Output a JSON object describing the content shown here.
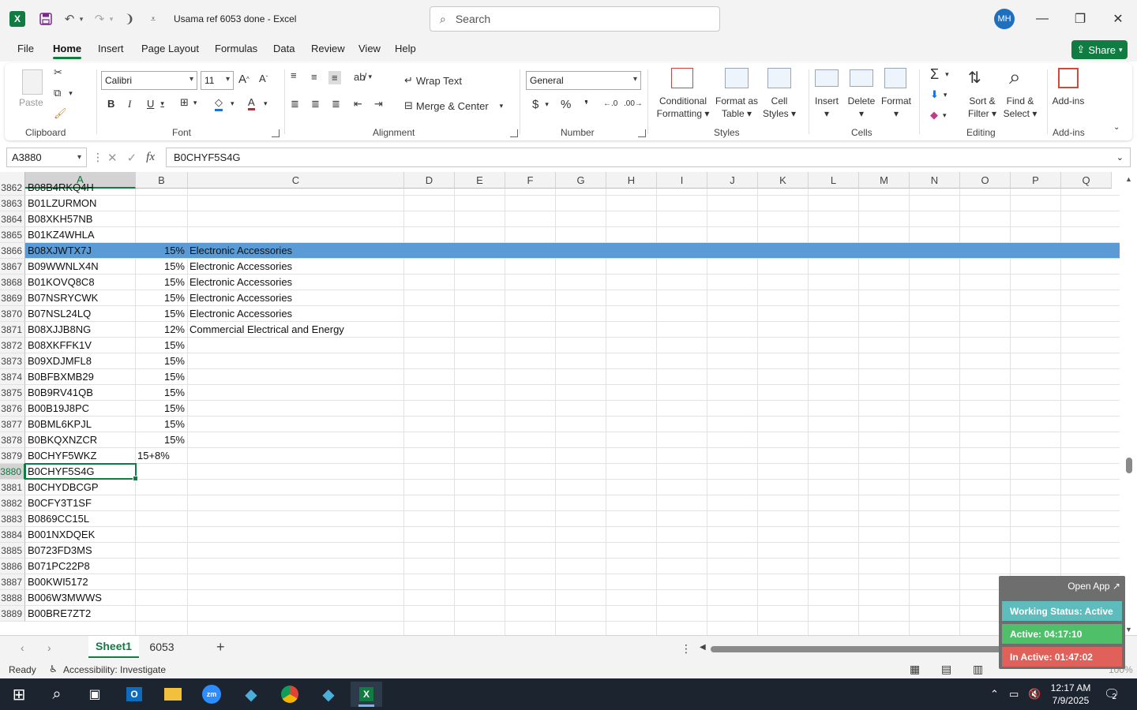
{
  "titlebar": {
    "doc_title": "Usama ref 6053 done  -  Excel",
    "search_placeholder": "Search",
    "avatar_initials": "MH",
    "qa_icons": [
      "save-icon",
      "undo-icon",
      "redo-icon",
      "touch-mode-icon",
      "customize-icon"
    ]
  },
  "menu": {
    "tabs": [
      "File",
      "Home",
      "Insert",
      "Page Layout",
      "Formulas",
      "Data",
      "Review",
      "View",
      "Help"
    ],
    "active_tab": "Home",
    "share_label": "Share"
  },
  "ribbon": {
    "clipboard": {
      "label": "Clipboard",
      "paste": "Paste"
    },
    "font": {
      "label": "Font",
      "name": "Calibri",
      "size": "11"
    },
    "alignment": {
      "label": "Alignment",
      "wrap": "Wrap Text",
      "merge": "Merge & Center"
    },
    "number": {
      "label": "Number",
      "format": "General"
    },
    "styles": {
      "label": "Styles",
      "cond1": "Conditional",
      "cond2": "Formatting",
      "fmt1": "Format as",
      "fmt2": "Table",
      "cell1": "Cell",
      "cell2": "Styles"
    },
    "cells": {
      "label": "Cells",
      "insert": "Insert",
      "delete": "Delete",
      "format": "Format"
    },
    "editing": {
      "label": "Editing",
      "sort1": "Sort &",
      "sort2": "Filter",
      "find1": "Find &",
      "find2": "Select"
    },
    "addins": {
      "label": "Add-ins",
      "button": "Add-ins"
    }
  },
  "formula_bar": {
    "name_box": "A3880",
    "content": "B0CHYF5S4G"
  },
  "grid": {
    "columns": [
      "A",
      "B",
      "C",
      "D",
      "E",
      "F",
      "G",
      "H",
      "I",
      "J",
      "K",
      "L",
      "M",
      "N",
      "O",
      "P",
      "Q"
    ],
    "selected_column": "A",
    "rows": [
      {
        "n": "3862",
        "a": "B08B4RKQ4H",
        "b": "",
        "c": ""
      },
      {
        "n": "3863",
        "a": "B01LZURMON",
        "b": "",
        "c": ""
      },
      {
        "n": "3864",
        "a": "B08XKH57NB",
        "b": "",
        "c": ""
      },
      {
        "n": "3865",
        "a": "B01KZ4WHLA",
        "b": "",
        "c": ""
      },
      {
        "n": "3866",
        "a": "B08XJWTX7J",
        "b": "15%",
        "c": "Electronic Accessories",
        "highlight": true
      },
      {
        "n": "3867",
        "a": "B09WWNLX4N",
        "b": "15%",
        "c": "Electronic Accessories"
      },
      {
        "n": "3868",
        "a": "B01KOVQ8C8",
        "b": "15%",
        "c": "Electronic Accessories"
      },
      {
        "n": "3869",
        "a": "B07NSRYCWK",
        "b": "15%",
        "c": "Electronic Accessories"
      },
      {
        "n": "3870",
        "a": "B07NSL24LQ",
        "b": "15%",
        "c": "Electronic Accessories"
      },
      {
        "n": "3871",
        "a": "B08XJJB8NG",
        "b": "12%",
        "c": "Commercial Electrical and Energy"
      },
      {
        "n": "3872",
        "a": "B08XKFFK1V",
        "b": "15%",
        "c": ""
      },
      {
        "n": "3873",
        "a": "B09XDJMFL8",
        "b": "15%",
        "c": ""
      },
      {
        "n": "3874",
        "a": "B0BFBXMB29",
        "b": "15%",
        "c": ""
      },
      {
        "n": "3875",
        "a": "B0B9RV41QB",
        "b": "15%",
        "c": ""
      },
      {
        "n": "3876",
        "a": "B00B19J8PC",
        "b": "15%",
        "c": ""
      },
      {
        "n": "3877",
        "a": "B0BML6KPJL",
        "b": "15%",
        "c": ""
      },
      {
        "n": "3878",
        "a": "B0BKQXNZCR",
        "b": "15%",
        "c": ""
      },
      {
        "n": "3879",
        "a": "B0CHYF5WKZ",
        "b": "15+8%",
        "c": "",
        "b_left": true
      },
      {
        "n": "3880",
        "a": "B0CHYF5S4G",
        "b": "",
        "c": "",
        "active": true
      },
      {
        "n": "3881",
        "a": "B0CHYDBCGP",
        "b": "",
        "c": ""
      },
      {
        "n": "3882",
        "a": "B0CFY3T1SF",
        "b": "",
        "c": ""
      },
      {
        "n": "3883",
        "a": "B0869CC15L",
        "b": "",
        "c": ""
      },
      {
        "n": "3884",
        "a": "B001NXDQEK",
        "b": "",
        "c": ""
      },
      {
        "n": "3885",
        "a": "B0723FD3MS",
        "b": "",
        "c": ""
      },
      {
        "n": "3886",
        "a": "B071PC22P8",
        "b": "",
        "c": ""
      },
      {
        "n": "3887",
        "a": "B00KWI5172",
        "b": "",
        "c": ""
      },
      {
        "n": "3888",
        "a": "B006W3MWWS",
        "b": "",
        "c": ""
      },
      {
        "n": "3889",
        "a": "B00BRE7ZT2",
        "b": "",
        "c": ""
      }
    ]
  },
  "sheets": {
    "tabs": [
      "Sheet1",
      "6053"
    ],
    "active": "Sheet1"
  },
  "status": {
    "ready": "Ready",
    "accessibility": "Accessibility: Investigate",
    "zoom": "100%"
  },
  "widget": {
    "open_app": "Open App ↗",
    "working": "Working Status: Active",
    "active": "Active: 04:17:10",
    "inactive": "In Active: 01:47:02",
    "colors": {
      "working": "#5fbcbc",
      "active": "#4fbf6a",
      "inactive": "#e0605a"
    }
  },
  "taskbar": {
    "apps": [
      "start-icon",
      "search-icon",
      "task-view-icon",
      "outlook-icon",
      "file-explorer-icon",
      "zoom-icon",
      "app-icon",
      "chrome-icon",
      "app-icon",
      "excel-icon"
    ],
    "time": "12:17 AM",
    "date": "7/9/2025",
    "notification_count": "2"
  },
  "colors": {
    "accent": "#107c41",
    "highlight_row": "#5b9bd5"
  }
}
